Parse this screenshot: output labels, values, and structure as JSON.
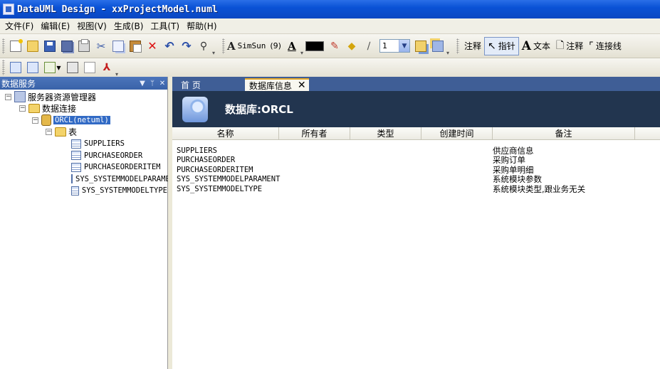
{
  "window": {
    "title": "DataUML Design - xxProjectModel.numl"
  },
  "menu": [
    {
      "label": "文件(F)"
    },
    {
      "label": "编辑(E)"
    },
    {
      "label": "视图(V)"
    },
    {
      "label": "生成(B)"
    },
    {
      "label": "工具(T)"
    },
    {
      "label": "帮助(H)"
    }
  ],
  "toolbar": {
    "font_name": "SimSun",
    "font_size": "(9)",
    "line_width": "1",
    "annotate_label": "注释",
    "pointer_label": "指针",
    "text_label": "文本",
    "note_label": "注释",
    "connector_label": "连接线"
  },
  "left_panel": {
    "title": "数据服务",
    "tree": {
      "root": "服务器资源管理器",
      "connections": "数据连接",
      "db": "ORCL(netuml)",
      "tables_folder": "表",
      "tables": [
        "SUPPLIERS",
        "PURCHASEORDER",
        "PURCHASEORDERITEM",
        "SYS_SYSTEMMODELPARAMENT",
        "SYS_SYSTEMMODELTYPE"
      ]
    }
  },
  "tabs": [
    {
      "label": "首 页"
    },
    {
      "label": "数据库信息"
    }
  ],
  "db_info": {
    "title": "数据库:ORCL",
    "columns": [
      "名称",
      "所有者",
      "类型",
      "创建时间",
      "备注"
    ],
    "rows": [
      {
        "name": "SUPPLIERS",
        "note": "供应商信息"
      },
      {
        "name": "PURCHASEORDER",
        "note": "采购订单"
      },
      {
        "name": "PURCHASEORDERITEM",
        "note": "采购单明细"
      },
      {
        "name": "SYS_SYSTEMMODELPARAMENT",
        "note": "系统模块参数"
      },
      {
        "name": "SYS_SYSTEMMODELTYPE",
        "note": "系统模块类型,跟业务无关"
      }
    ]
  },
  "colors": {
    "titlebar": "#0a52d6",
    "panel_header": "#3a63a9",
    "db_header": "#22354f",
    "selection": "#316ac5"
  }
}
